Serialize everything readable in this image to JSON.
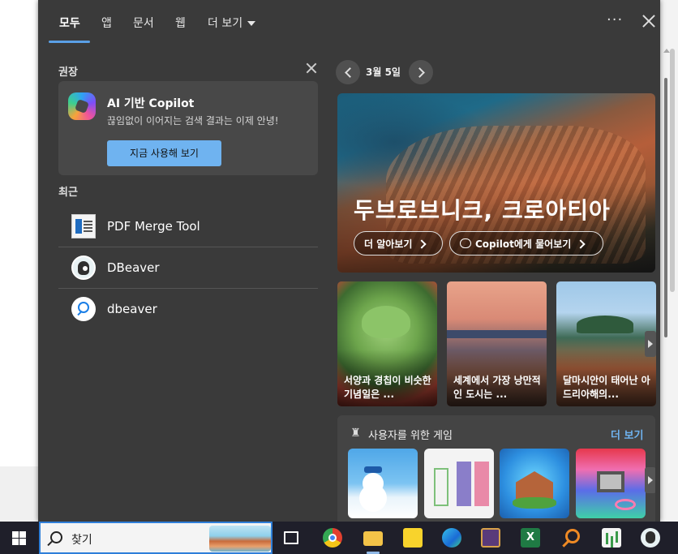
{
  "tabs": [
    {
      "label": "모두",
      "active": true
    },
    {
      "label": "앱"
    },
    {
      "label": "문서"
    },
    {
      "label": "웹"
    },
    {
      "label": "더 보기"
    }
  ],
  "header": {
    "more_dots": "···"
  },
  "recommended": {
    "title": "권장",
    "copilot": {
      "title": "AI 기반 Copilot",
      "subtitle": "끊임없이 이어지는 검색 결과는 이제 안녕!",
      "button": "지금 사용해 보기"
    }
  },
  "recent": {
    "title": "최근",
    "items": [
      {
        "label": "PDF Merge Tool",
        "icon": "pdf-merge-icon"
      },
      {
        "label": "DBeaver",
        "icon": "dbeaver-icon"
      },
      {
        "label": "dbeaver",
        "icon": "search-app-icon"
      }
    ]
  },
  "today": {
    "date": "3월 5일",
    "hero": {
      "title": "두브로브니크, 크로아티아",
      "learn_more": "더 알아보기",
      "ask_copilot": "Copilot에게 물어보기"
    },
    "tiles": [
      {
        "caption": "서양과 경칩이 비슷한 기념일은 ..."
      },
      {
        "caption": "세계에서 가장 낭만적인 도시는 ..."
      },
      {
        "caption": "달마시안이 태어난 아드리아해의..."
      }
    ]
  },
  "games": {
    "title": "사용자를 위한 게임",
    "more": "더 보기"
  },
  "taskbar": {
    "search_placeholder": "찾기",
    "excel_letter": "X"
  },
  "colors": {
    "panel_bg": "#3a3a3a",
    "accent": "#6fb3f0",
    "taskbar_bg": "#1f1f2a"
  }
}
